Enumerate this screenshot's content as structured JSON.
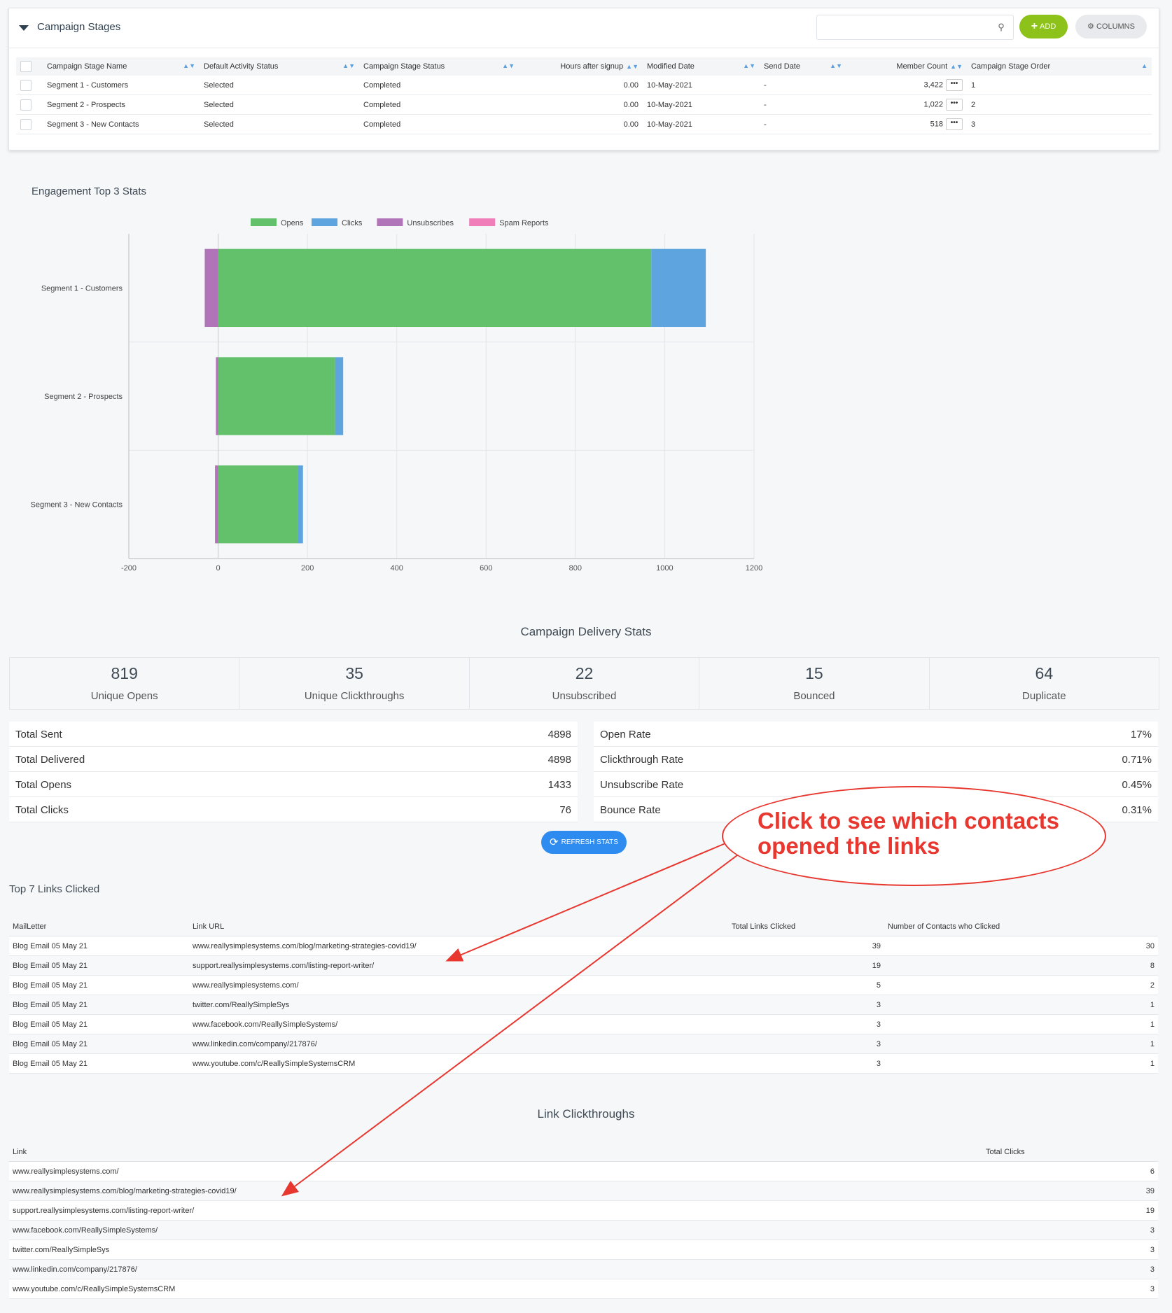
{
  "stages_panel": {
    "title": "Campaign Stages",
    "search_placeholder": "",
    "add_label": "ADD",
    "columns_label": "COLUMNS",
    "headers": [
      "Campaign Stage Name",
      "Default Activity Status",
      "Campaign Stage Status",
      "Hours after signup",
      "Modified Date",
      "Send Date",
      "Member Count",
      "Campaign Stage Order"
    ],
    "rows": [
      {
        "name": "Segment 1 - Customers",
        "activity": "Selected",
        "status": "Completed",
        "hours": "0.00",
        "modified": "10-May-2021",
        "send": "-",
        "members": "3,422",
        "order": "1"
      },
      {
        "name": "Segment 2 - Prospects",
        "activity": "Selected",
        "status": "Completed",
        "hours": "0.00",
        "modified": "10-May-2021",
        "send": "-",
        "members": "1,022",
        "order": "2"
      },
      {
        "name": "Segment 3 - New Contacts",
        "activity": "Selected",
        "status": "Completed",
        "hours": "0.00",
        "modified": "10-May-2021",
        "send": "-",
        "members": "518",
        "order": "3"
      }
    ]
  },
  "engagement": {
    "title": "Engagement Top 3 Stats"
  },
  "chart_data": {
    "type": "bar",
    "orientation": "horizontal",
    "stacked": true,
    "categories": [
      "Segment 1 - Customers",
      "Segment 2 - Prospects",
      "Segment 3 - New Contacts"
    ],
    "series": [
      {
        "name": "Opens",
        "color": "#62c16a",
        "values": [
          970,
          262,
          178
        ]
      },
      {
        "name": "Clicks",
        "color": "#5ea4de",
        "values": [
          122,
          18,
          12
        ]
      },
      {
        "name": "Unsubscribes",
        "color": "#b174b8",
        "values": [
          -30,
          -5,
          -7
        ]
      },
      {
        "name": "Spam Reports",
        "color": "#f07eb8",
        "values": [
          0,
          0,
          0
        ]
      }
    ],
    "xlim": [
      -200,
      1200
    ],
    "xticks": [
      "-200",
      "0",
      "200",
      "400",
      "600",
      "800",
      "1000",
      "1200"
    ],
    "grid": true,
    "legend": "top"
  },
  "delivery": {
    "title": "Campaign Delivery Stats",
    "boxes": [
      {
        "value": "819",
        "label": "Unique Opens"
      },
      {
        "value": "35",
        "label": "Unique Clickthroughs"
      },
      {
        "value": "22",
        "label": "Unsubscribed"
      },
      {
        "value": "15",
        "label": "Bounced"
      },
      {
        "value": "64",
        "label": "Duplicate"
      }
    ],
    "left": [
      {
        "k": "Total Sent",
        "v": "4898"
      },
      {
        "k": "Total Delivered",
        "v": "4898"
      },
      {
        "k": "Total Opens",
        "v": "1433"
      },
      {
        "k": "Total Clicks",
        "v": "76"
      }
    ],
    "right": [
      {
        "k": "Open Rate",
        "v": "17%"
      },
      {
        "k": "Clickthrough Rate",
        "v": "0.71%"
      },
      {
        "k": "Unsubscribe Rate",
        "v": "0.45%"
      },
      {
        "k": "Bounce Rate",
        "v": "0.31%"
      }
    ],
    "refresh_label": "REFRESH STATS"
  },
  "callout": {
    "line1": "Click to see which contacts",
    "line2": "opened the links"
  },
  "top_links": {
    "title": "Top 7 Links Clicked",
    "headers": [
      "MailLetter",
      "Link URL",
      "Total Links Clicked",
      "Number of Contacts who Clicked"
    ],
    "rows": [
      [
        "Blog Email 05 May 21",
        "www.reallysimplesystems.com/blog/marketing-strategies-covid19/",
        "39",
        "30"
      ],
      [
        "Blog Email 05 May 21",
        "support.reallysimplesystems.com/listing-report-writer/",
        "19",
        "8"
      ],
      [
        "Blog Email 05 May 21",
        "www.reallysimplesystems.com/",
        "5",
        "2"
      ],
      [
        "Blog Email 05 May 21",
        "twitter.com/ReallySimpleSys",
        "3",
        "1"
      ],
      [
        "Blog Email 05 May 21",
        "www.facebook.com/ReallySimpleSystems/",
        "3",
        "1"
      ],
      [
        "Blog Email 05 May 21",
        "www.linkedin.com/company/217876/",
        "3",
        "1"
      ],
      [
        "Blog Email 05 May 21",
        "www.youtube.com/c/ReallySimpleSystemsCRM",
        "3",
        "1"
      ]
    ]
  },
  "clickthroughs": {
    "title": "Link Clickthroughs",
    "headers": [
      "Link",
      "Total Clicks"
    ],
    "rows": [
      [
        "www.reallysimplesystems.com/",
        "6"
      ],
      [
        "www.reallysimplesystems.com/blog/marketing-strategies-covid19/",
        "39"
      ],
      [
        "support.reallysimplesystems.com/listing-report-writer/",
        "19"
      ],
      [
        "www.facebook.com/ReallySimpleSystems/",
        "3"
      ],
      [
        "twitter.com/ReallySimpleSys",
        "3"
      ],
      [
        "www.linkedin.com/company/217876/",
        "3"
      ],
      [
        "www.youtube.com/c/ReallySimpleSystemsCRM",
        "3"
      ]
    ]
  }
}
